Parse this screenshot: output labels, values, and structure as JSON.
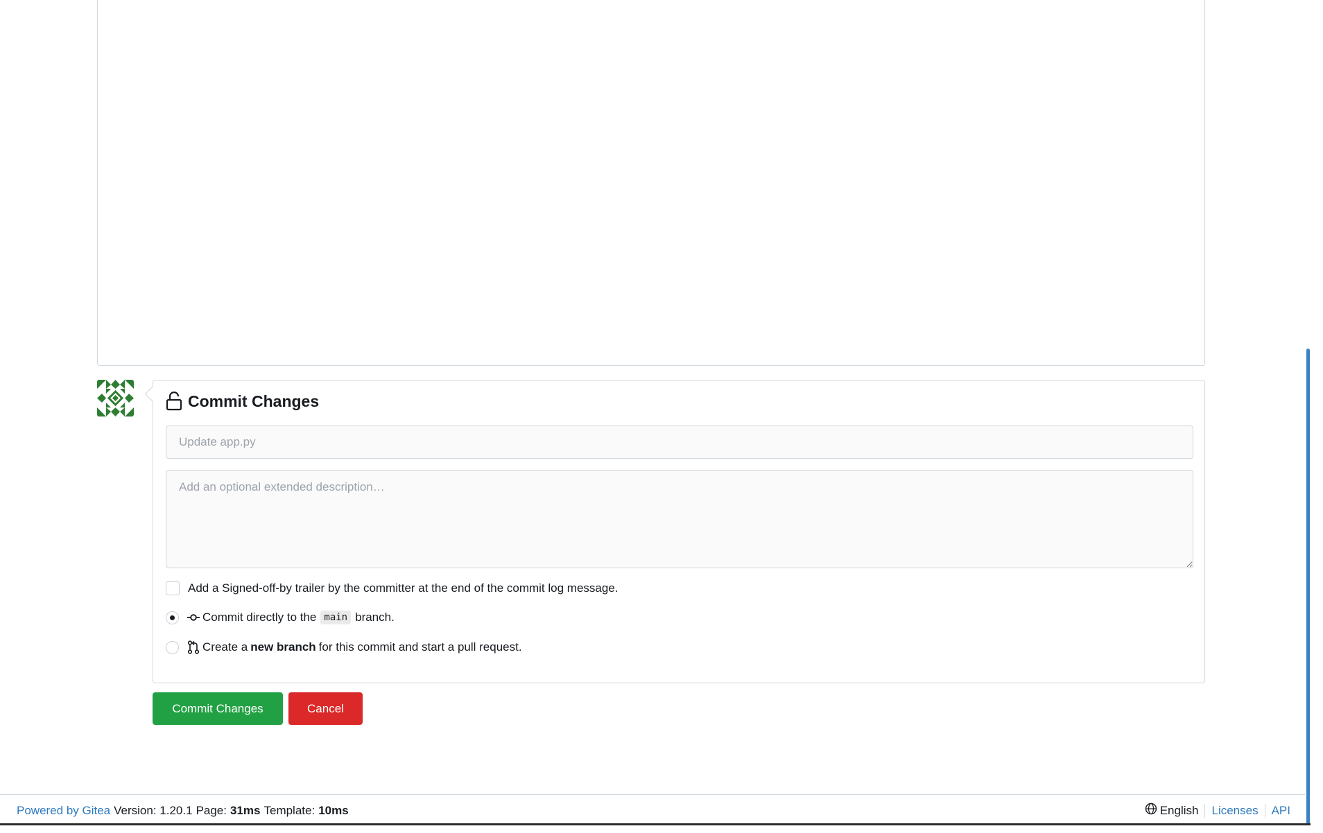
{
  "commit": {
    "header": "Commit Changes",
    "summary_placeholder": "Update app.py",
    "description_placeholder": "Add an optional extended description…",
    "signoff_label": "Add a Signed-off-by trailer by the committer at the end of the commit log message.",
    "direct_prefix": "Commit directly to the",
    "branch_name": "main",
    "direct_suffix": "branch.",
    "newbranch_prefix": "Create a",
    "newbranch_bold": "new branch",
    "newbranch_suffix": "for this commit and start a pull request.",
    "signoff_checked": false,
    "selected_option": "direct"
  },
  "buttons": {
    "commit_label": "Commit Changes",
    "cancel_label": "Cancel"
  },
  "footer": {
    "powered_by": "Powered by Gitea",
    "version_label": "Version: 1.20.1",
    "page_label": "Page:",
    "page_time": "31ms",
    "template_label": "Template:",
    "template_time": "10ms",
    "language": "English",
    "licenses": "Licenses",
    "api": "API"
  },
  "colors": {
    "commit_button": "#21a143",
    "cancel_button": "#db2828",
    "link": "#2f7ac0",
    "avatar": "#2e7d32"
  },
  "icons": {
    "header": "unlock-icon",
    "direct": "git-commit-icon",
    "newbranch": "git-pull-request-icon",
    "language": "globe-icon"
  }
}
